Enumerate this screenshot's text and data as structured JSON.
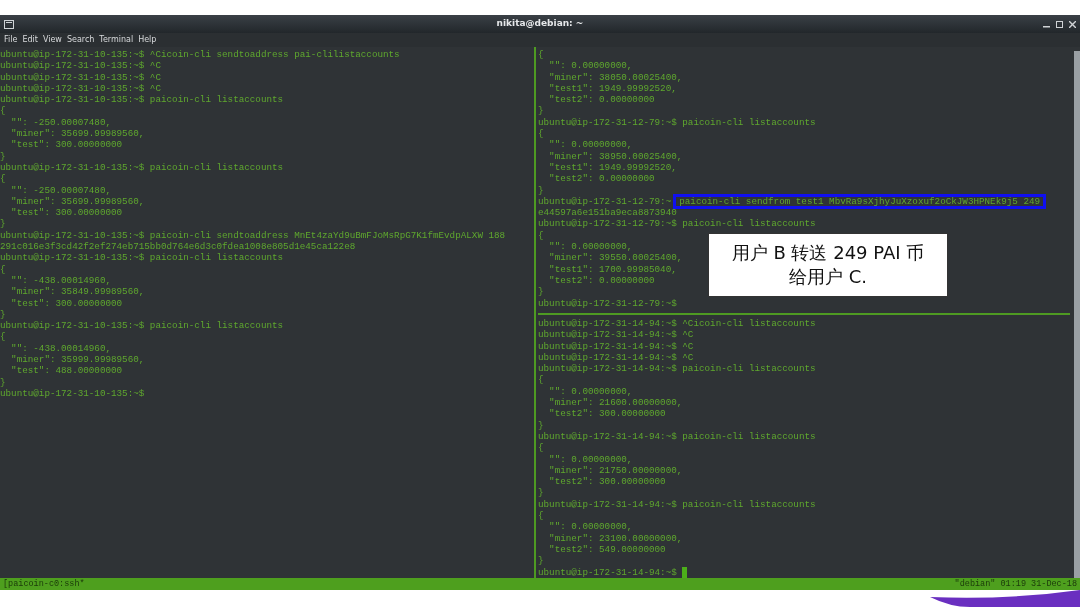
{
  "window": {
    "title": "nikita@debian: ~"
  },
  "menu": [
    "File",
    "Edit",
    "View",
    "Search",
    "Terminal",
    "Help"
  ],
  "left_pane": {
    "lines": [
      {
        "text": "ubuntu@ip-172-31-10-135:~$ ^Cicoin-cli sendtoaddress pai-clilistaccounts"
      },
      {
        "text": "ubuntu@ip-172-31-10-135:~$ ^C"
      },
      {
        "text": "ubuntu@ip-172-31-10-135:~$ ^C"
      },
      {
        "text": "ubuntu@ip-172-31-10-135:~$ ^C"
      },
      {
        "text": "ubuntu@ip-172-31-10-135:~$ paicoin-cli listaccounts"
      },
      {
        "text": "{"
      },
      {
        "text": "  \"\": -250.00007480,"
      },
      {
        "text": "  \"miner\": 35699.99989560,"
      },
      {
        "text": "  \"test\": 300.00000000"
      },
      {
        "text": "}"
      },
      {
        "text": "ubuntu@ip-172-31-10-135:~$ paicoin-cli listaccounts"
      },
      {
        "text": "{"
      },
      {
        "text": "  \"\": -250.00007480,"
      },
      {
        "text": "  \"miner\": 35699.99989560,"
      },
      {
        "text": "  \"test\": 300.00000000"
      },
      {
        "text": "}"
      },
      {
        "text": "ubuntu@ip-172-31-10-135:~$ paicoin-cli sendtoaddress MnEt4zaYd9uBmFJoMsRpG7K1fmEvdpALXW 188"
      },
      {
        "text": "291c016e3f3cd42f2ef274eb715bb0d764e6d3c0fdea1008e805d1e45ca122e8"
      },
      {
        "text": "ubuntu@ip-172-31-10-135:~$ paicoin-cli listaccounts"
      },
      {
        "text": "{"
      },
      {
        "text": "  \"\": -438.00014960,"
      },
      {
        "text": "  \"miner\": 35849.99989560,"
      },
      {
        "text": "  \"test\": 300.00000000"
      },
      {
        "text": "}"
      },
      {
        "text": "ubuntu@ip-172-31-10-135:~$ paicoin-cli listaccounts"
      },
      {
        "text": "{"
      },
      {
        "text": "  \"\": -438.00014960,"
      },
      {
        "text": "  \"miner\": 35999.99989560,"
      },
      {
        "text": "  \"test\": 488.00000000"
      },
      {
        "text": "}"
      },
      {
        "text": "ubuntu@ip-172-31-10-135:~$"
      }
    ]
  },
  "right_top_pane": {
    "lines": [
      {
        "text": "{"
      },
      {
        "text": "  \"\": 0.00000000,"
      },
      {
        "text": "  \"miner\": 38050.00025400,"
      },
      {
        "text": "  \"test1\": 1949.99992520,"
      },
      {
        "text": "  \"test2\": 0.00000000"
      },
      {
        "text": "}"
      },
      {
        "text": "ubuntu@ip-172-31-12-79:~$ paicoin-cli listaccounts"
      },
      {
        "text": "{"
      },
      {
        "text": "  \"\": 0.00000000,"
      },
      {
        "text": "  \"miner\": 38950.00025400,"
      },
      {
        "text": "  \"test1\": 1949.99992520,"
      },
      {
        "text": "  \"test2\": 0.00000000"
      },
      {
        "text": "}"
      },
      {
        "text": "ubuntu@ip-172-31-12-79:~",
        "command": "paicoin-cli sendfrom test1 MbvRa9sXjhyJuXzoxuf2oCkJW3HPNEk9j5 249",
        "highlighted": true
      },
      {
        "text": "e44597a6e151ba9eca8873940"
      },
      {
        "text": "ubuntu@ip-172-31-12-79:~$ paicoin-cli listaccounts"
      },
      {
        "text": "{"
      },
      {
        "text": "  \"\": 0.00000000,"
      },
      {
        "text": "  \"miner\": 39550.00025400,"
      },
      {
        "text": "  \"test1\": 1700.99985040,"
      },
      {
        "text": "  \"test2\": 0.00000000"
      },
      {
        "text": "}"
      },
      {
        "text": "ubuntu@ip-172-31-12-79:~$"
      }
    ]
  },
  "right_bottom_pane": {
    "lines": [
      {
        "text": "ubuntu@ip-172-31-14-94:~$ ^Cicoin-cli listaccounts"
      },
      {
        "text": "ubuntu@ip-172-31-14-94:~$ ^C"
      },
      {
        "text": "ubuntu@ip-172-31-14-94:~$ ^C"
      },
      {
        "text": "ubuntu@ip-172-31-14-94:~$ ^C"
      },
      {
        "text": "ubuntu@ip-172-31-14-94:~$ paicoin-cli listaccounts"
      },
      {
        "text": "{"
      },
      {
        "text": "  \"\": 0.00000000,"
      },
      {
        "text": "  \"miner\": 21600.00000000,"
      },
      {
        "text": "  \"test2\": 300.00000000"
      },
      {
        "text": "}"
      },
      {
        "text": "ubuntu@ip-172-31-14-94:~$ paicoin-cli listaccounts"
      },
      {
        "text": "{"
      },
      {
        "text": "  \"\": 0.00000000,"
      },
      {
        "text": "  \"miner\": 21750.00000000,"
      },
      {
        "text": "  \"test2\": 300.00000000"
      },
      {
        "text": "}"
      },
      {
        "text": "ubuntu@ip-172-31-14-94:~$ paicoin-cli listaccounts"
      },
      {
        "text": "{"
      },
      {
        "text": "  \"\": 0.00000000,"
      },
      {
        "text": "  \"miner\": 23100.00000000,"
      },
      {
        "text": "  \"test2\": 549.00000000"
      },
      {
        "text": "}"
      },
      {
        "text": "ubuntu@ip-172-31-14-94:~$",
        "cursor": true
      }
    ]
  },
  "callout": {
    "text": "用户 B 转送 249 PAI 币给用户 C."
  },
  "status_bar": {
    "left": "[paicoin-c0:ssh*",
    "right": "\"debian\" 01:19 31-Dec-18"
  }
}
